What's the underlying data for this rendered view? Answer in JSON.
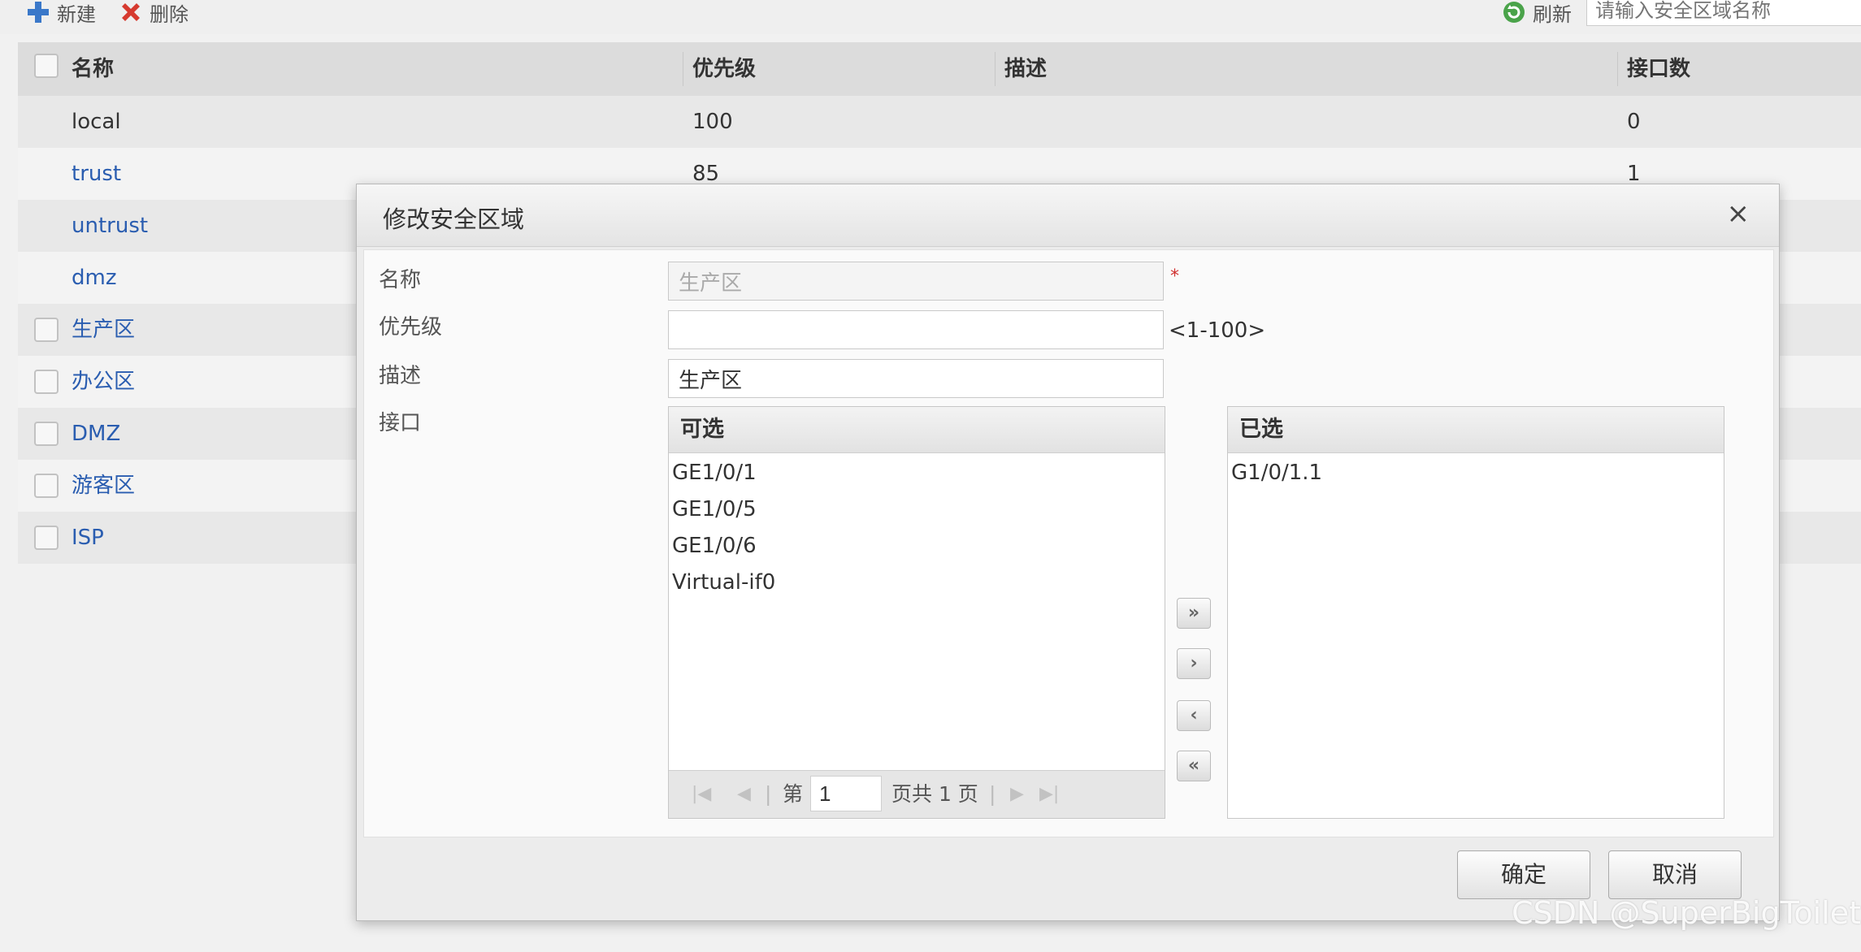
{
  "toolbar": {
    "new_label": "新建",
    "delete_label": "删除",
    "refresh_label": "刷新",
    "search_placeholder": "请输入安全区域名称"
  },
  "table": {
    "columns": {
      "name": "名称",
      "priority": "优先级",
      "description": "描述",
      "interfaces": "接口数"
    },
    "rows": [
      {
        "name": "local",
        "priority": "100",
        "interfaces": "0"
      },
      {
        "name": "trust",
        "priority": "85",
        "interfaces": "1"
      },
      {
        "name": "untrust",
        "priority": "",
        "interfaces": ""
      },
      {
        "name": "dmz",
        "priority": "",
        "interfaces": ""
      },
      {
        "name": "生产区",
        "priority": "",
        "interfaces": ""
      },
      {
        "name": "办公区",
        "priority": "",
        "interfaces": ""
      },
      {
        "name": "DMZ",
        "priority": "",
        "interfaces": ""
      },
      {
        "name": "游客区",
        "priority": "",
        "interfaces": ""
      },
      {
        "name": "ISP",
        "priority": "",
        "interfaces": ""
      }
    ]
  },
  "dialog": {
    "title": "修改安全区域",
    "close_symbol": "×",
    "labels": {
      "name": "名称",
      "priority": "优先级",
      "description": "描述",
      "interface": "接口"
    },
    "name_value": "生产区",
    "required_mark": "*",
    "priority_value": "",
    "priority_hint": "<1-100>",
    "description_value": "生产区",
    "available": {
      "header": "可选",
      "items": [
        "GE1/0/1",
        "GE1/0/5",
        "GE1/0/6",
        "Virtual-if0"
      ]
    },
    "selected": {
      "header": "已选",
      "items": [
        "G1/0/1.1"
      ]
    },
    "pager": {
      "page_prefix": "第",
      "page_value": "1",
      "page_suffix": "页共 1 页"
    },
    "move_buttons": {
      "all_right": "»",
      "right": "›",
      "left": "‹",
      "all_left": "«"
    },
    "ok_label": "确定",
    "cancel_label": "取消"
  },
  "watermark": "CSDN @SuperBigToilet"
}
